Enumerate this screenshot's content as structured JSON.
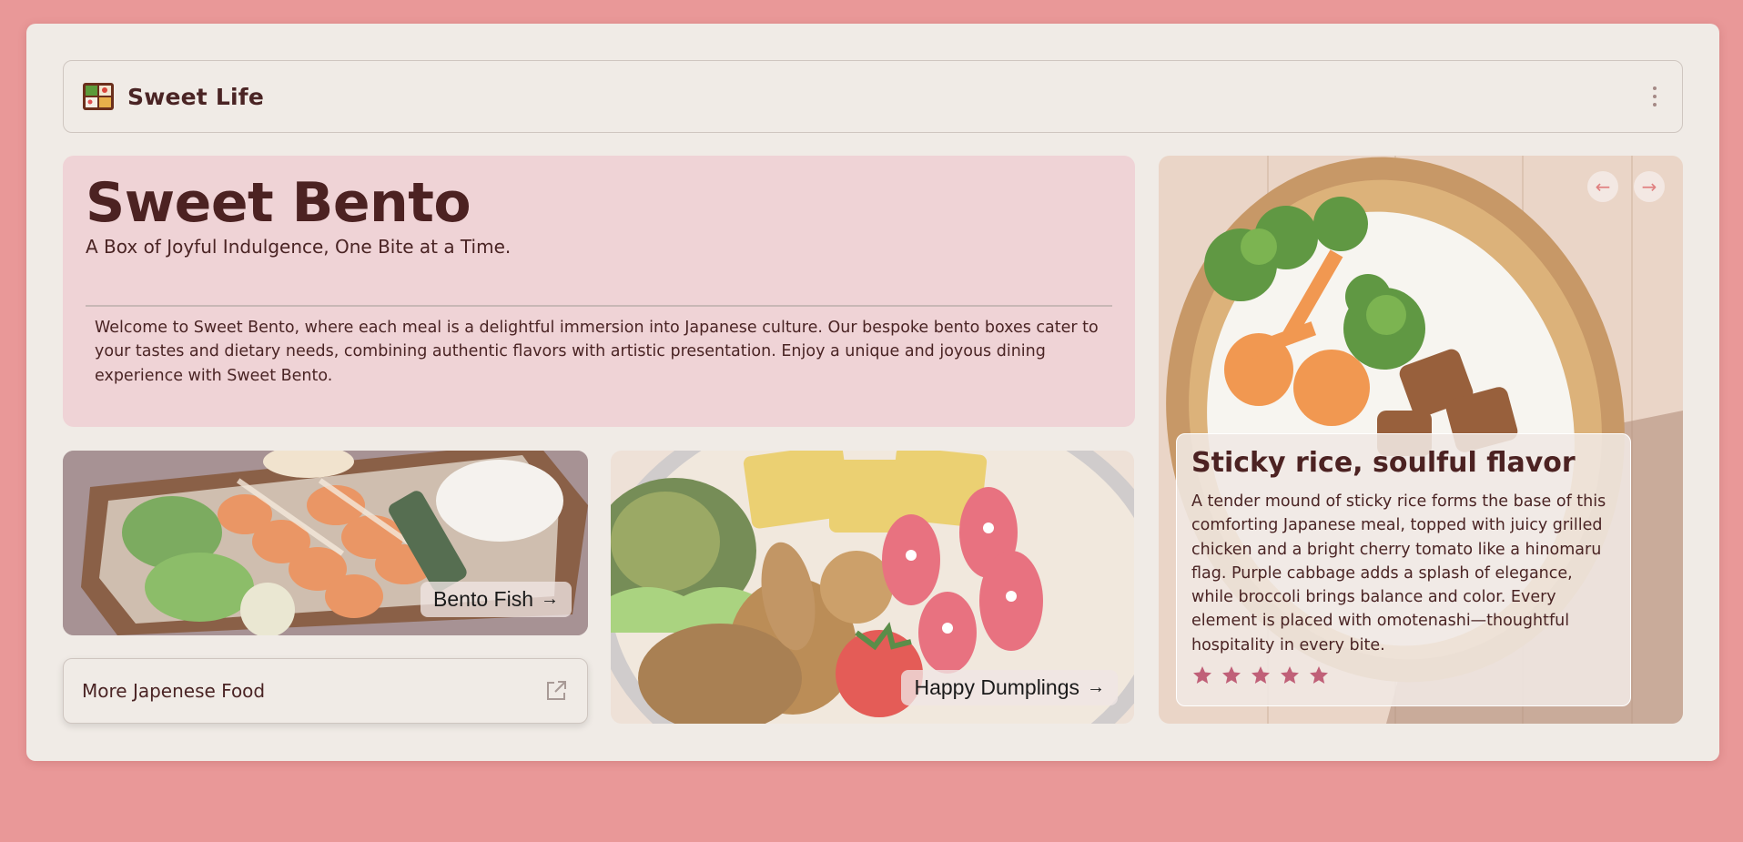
{
  "header": {
    "brand": "Sweet Life",
    "logo_icon": "bento-box-icon",
    "menu_icon": "kebab-menu-icon"
  },
  "hero": {
    "title": "Sweet Bento",
    "subtitle": "A Box of Joyful Indulgence, One Bite at a Time.",
    "description": "Welcome to Sweet Bento, where each meal is a delightful immersion into Japanese culture. Our bespoke bento boxes cater to your tastes and dietary needs, combining authentic flavors with artistic presentation. Enjoy a unique and joyous dining experience with Sweet Bento."
  },
  "tiles": {
    "fish": {
      "label": "Bento Fish",
      "arrow": "→"
    },
    "dumplings": {
      "label": "Happy Dumplings",
      "arrow": "→"
    }
  },
  "more_link": {
    "label": "More Japenese Food",
    "icon": "external-link-icon"
  },
  "feature": {
    "prev": "←",
    "next": "→",
    "title": "Sticky rice, soulful flavor",
    "text": "A tender mound of sticky rice forms the base of this comforting Japanese meal, topped with juicy grilled chicken and a bright cherry tomato like a hinomaru flag. Purple cabbage adds a splash of elegance, while broccoli brings balance and color. Every element is placed with omotenashi—thoughtful hospitality in every bite.",
    "rating": 5,
    "rating_max": 5
  },
  "colors": {
    "page_bg": "#e99898",
    "card_bg": "#f0ebe6",
    "hero_bg": "#efd3d6",
    "text": "#4a2424",
    "star": "#c06078"
  }
}
